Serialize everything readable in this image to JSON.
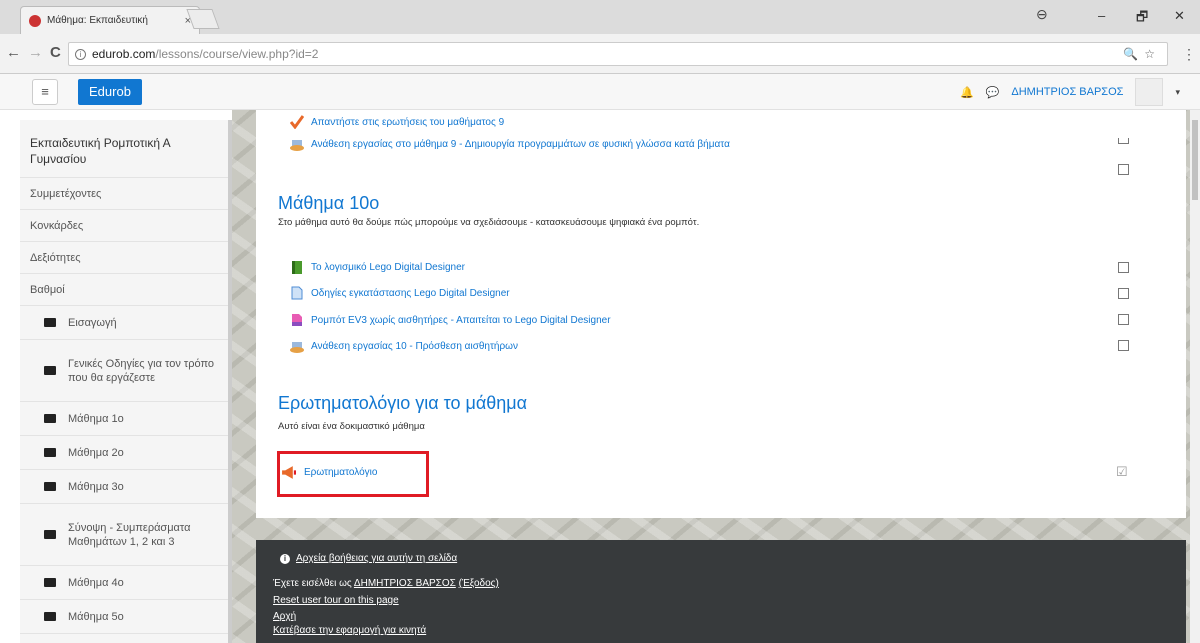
{
  "browser": {
    "tab_title": "Μάθημα: Εκπαιδευτική",
    "tab_close": "×",
    "url_host": "edurob.com",
    "url_path": "/lessons/course/view.php?id=2",
    "omni_icons": "🔍☆",
    "win_minimize": "–",
    "win_maximize": "🗗",
    "win_close": "✕",
    "back": "←",
    "forward": "→",
    "reload": "C",
    "menu": "⋮",
    "profile": "⊖"
  },
  "navbar": {
    "menu_icon": "≡",
    "brand": "Edurob",
    "user_name": "ΔΗΜΗΤΡΙΟΣ ΒΑΡΣΟΣ",
    "caret": "▾",
    "bell": "🔔",
    "chat": "💬"
  },
  "sidebar": {
    "course_title": "Εκπαιδευτική Ρομποτική Α Γυμνασίου",
    "items": [
      "Συμμετέχοντες",
      "Κονκάρδες",
      "Δεξιότητες",
      "Βαθμοί"
    ],
    "folders": [
      "Εισαγωγή",
      "Γενικές Οδηγίες για τον τρόπο που θα εργάζεστε",
      "Μάθημα 1ο",
      "Μάθημα 2ο",
      "Μάθημα 3ο",
      "Σύνοψη - Συμπεράσματα Μαθημάτων 1, 2 και 3",
      "Μάθημα 4ο",
      "Μάθημα 5ο"
    ]
  },
  "main": {
    "prev_activities": [
      "Απαντήστε στις ερωτήσεις του μαθήματος 9",
      "Ανάθεση εργασίας στο μάθημα 9 - Δημιουργία προγραμμάτων σε φυσική γλώσσα κατά βήματα"
    ],
    "section10": {
      "title": "Μάθημα 10ο",
      "summary": "Στο μάθημα αυτό θα δούμε πώς μπορούμε να σχεδιάσουμε - κατασκευάσουμε ψηφιακά ένα ρομπότ.",
      "activities": [
        "Το λογισμικό Lego Digital Designer",
        "Οδηγίες εγκατάστασης Lego Digital Designer",
        "Ρομπότ EV3 χωρίς αισθητήρες - Απαιτείται το Lego Digital Designer",
        "Ανάθεση εργασίας 10 - Πρόσθεση αισθητήρων"
      ]
    },
    "questionnaire_section": {
      "title": "Ερωτηματολόγιο για το μάθημα",
      "summary": "Αυτό είναι ένα δοκιμαστικό μάθημα",
      "activity": "Ερωτηματολόγιο",
      "completed_mark": "☑"
    }
  },
  "footer": {
    "help_link": "Αρχεία βοήθειας για αυτήν τη σελίδα",
    "logged_in_prefix": "Έχετε εισέλθει ως ",
    "logged_in_user": "ΔΗΜΗΤΡΙΟΣ ΒΑΡΣΟΣ",
    "logout": "(Έξοδος)",
    "reset_tour": "Reset user tour on this page",
    "home": "Αρχή",
    "mobile_app": "Κατέβασε την εφαρμογή για κινητά",
    "info_icon": "i"
  }
}
